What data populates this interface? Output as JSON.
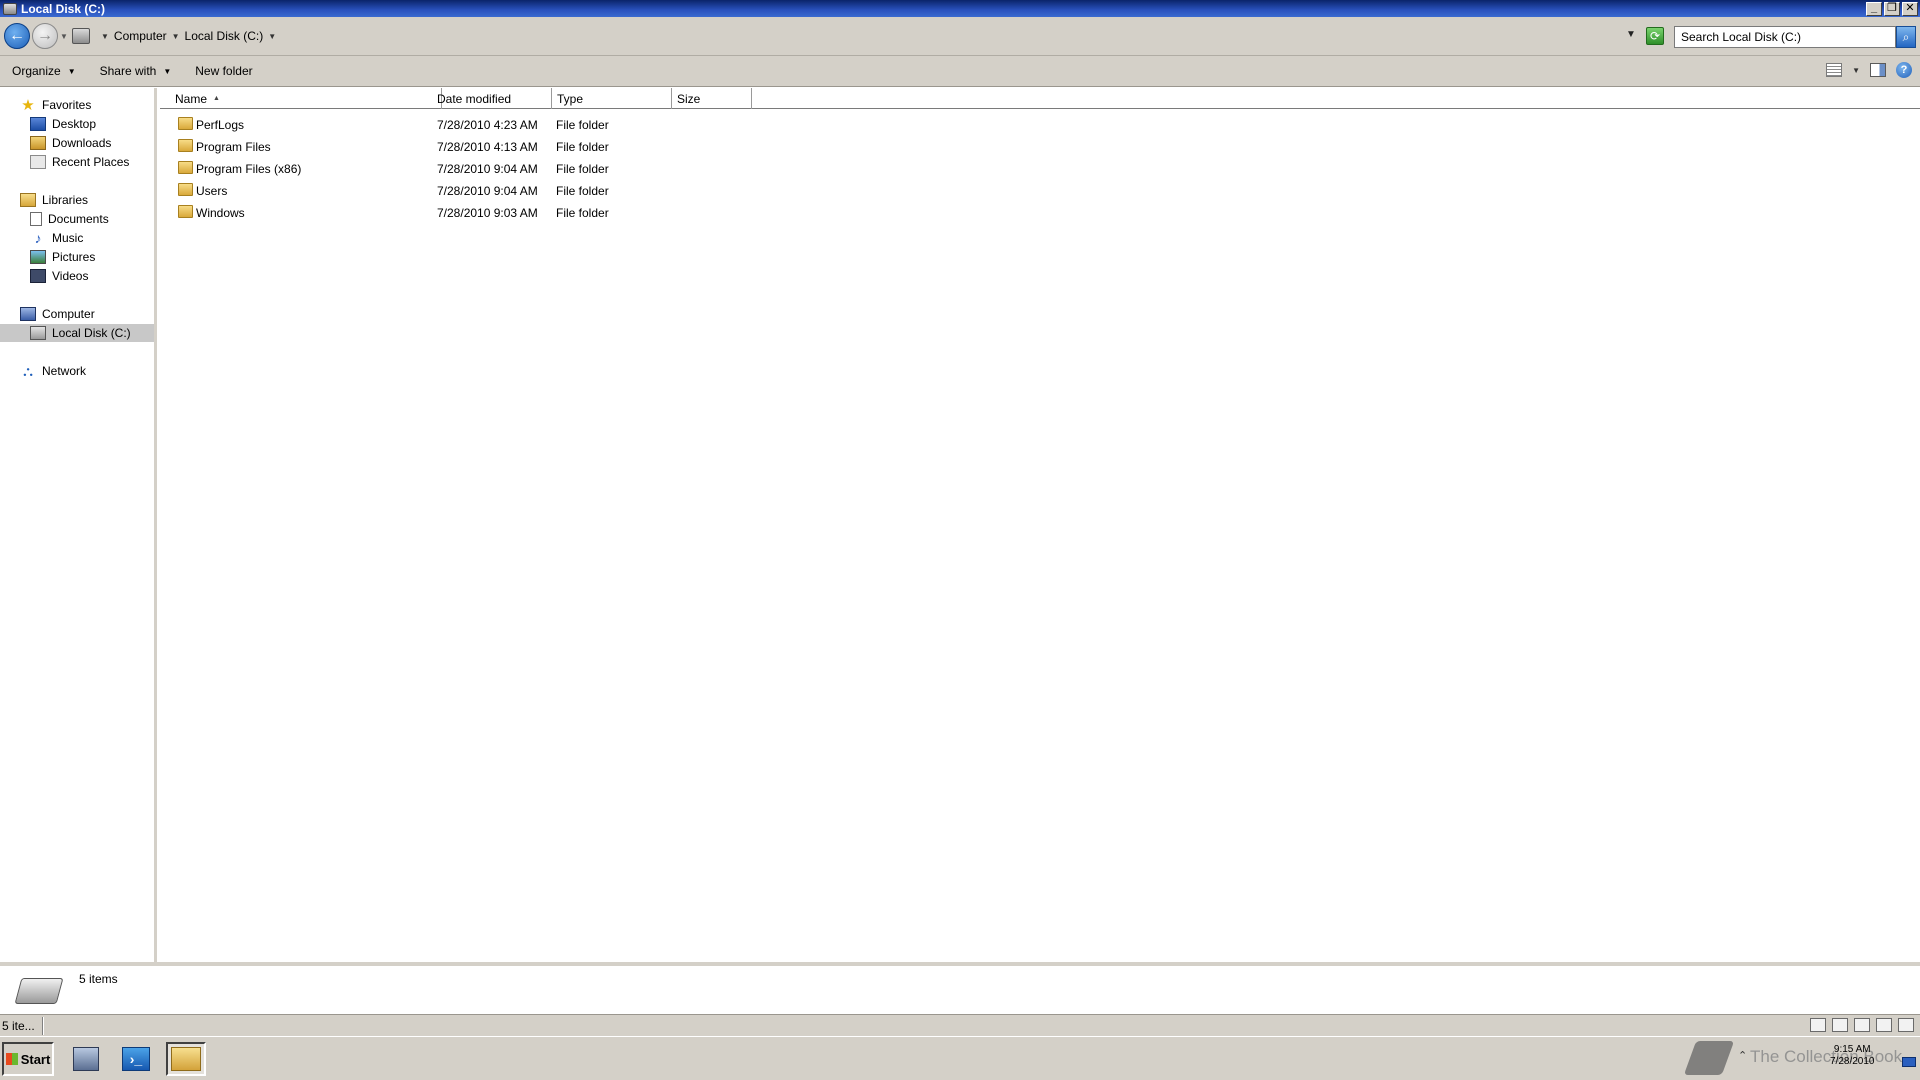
{
  "window": {
    "title": "Local Disk (C:)"
  },
  "address": {
    "crumbs": [
      "Computer",
      "Local Disk (C:)"
    ],
    "search_placeholder": "Search Local Disk (C:)"
  },
  "toolbar": {
    "organize": "Organize",
    "share_with": "Share with",
    "new_folder": "New folder"
  },
  "nav": {
    "favorites": "Favorites",
    "desktop": "Desktop",
    "downloads": "Downloads",
    "recent_places": "Recent Places",
    "libraries": "Libraries",
    "documents": "Documents",
    "music": "Music",
    "pictures": "Pictures",
    "videos": "Videos",
    "computer": "Computer",
    "local_disk": "Local Disk (C:)",
    "network": "Network"
  },
  "columns": {
    "name": "Name",
    "date_modified": "Date modified",
    "type": "Type",
    "size": "Size"
  },
  "files": [
    {
      "name": "PerfLogs",
      "date": "7/28/2010 4:23 AM",
      "type": "File folder",
      "size": ""
    },
    {
      "name": "Program Files",
      "date": "7/28/2010 4:13 AM",
      "type": "File folder",
      "size": ""
    },
    {
      "name": "Program Files (x86)",
      "date": "7/28/2010 9:04 AM",
      "type": "File folder",
      "size": ""
    },
    {
      "name": "Users",
      "date": "7/28/2010 9:04 AM",
      "type": "File folder",
      "size": ""
    },
    {
      "name": "Windows",
      "date": "7/28/2010 9:03 AM",
      "type": "File folder",
      "size": ""
    }
  ],
  "details": {
    "item_count": "5 items"
  },
  "status": {
    "text": "5 ite..."
  },
  "taskbar": {
    "start": "Start",
    "clock_time": "9:15 AM",
    "clock_date": "7/28/2010",
    "watermark": "The Collection Book"
  },
  "colors": {
    "chrome": "#d4d0c8",
    "titlebar": "#0a246a",
    "selection": "#c8c8c8"
  }
}
